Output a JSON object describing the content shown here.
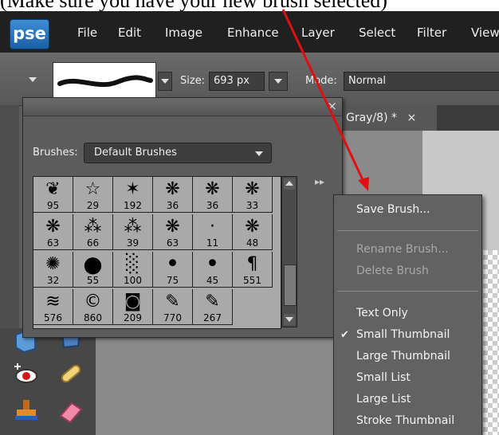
{
  "caption": {
    "text": "(Make sure you have your new brush selected)"
  },
  "app": {
    "logo": "pse"
  },
  "menubar": {
    "items": [
      "File",
      "Edit",
      "Image",
      "Enhance",
      "Layer",
      "Select",
      "Filter",
      "View"
    ]
  },
  "options_bar": {
    "size_label": "Size:",
    "size_value": "693 px",
    "mode_label": "Mode:",
    "mode_value": "Normal"
  },
  "document_tab": {
    "title": "Gray/8) *",
    "close": "×"
  },
  "brush_picker": {
    "brushes_label": "Brushes:",
    "brush_set": "Default Brushes",
    "close": "×",
    "expand": "▸▸",
    "brushes": [
      {
        "size": "95",
        "icon": "leaf-brush-icon"
      },
      {
        "size": "29",
        "icon": "star-brush-icon"
      },
      {
        "size": "192",
        "icon": "starburst-brush-icon"
      },
      {
        "size": "36",
        "icon": "grunge-brush-icon"
      },
      {
        "size": "36",
        "icon": "grunge-brush-icon"
      },
      {
        "size": "33",
        "icon": "grunge-brush-icon"
      },
      {
        "size": "63",
        "icon": "grunge-brush-icon"
      },
      {
        "size": "66",
        "icon": "spatter-brush-icon"
      },
      {
        "size": "39",
        "icon": "spatter-brush-icon"
      },
      {
        "size": "63",
        "icon": "grunge-brush-icon"
      },
      {
        "size": "11",
        "icon": "dot-brush-icon"
      },
      {
        "size": "48",
        "icon": "grunge-brush-icon"
      },
      {
        "size": "32",
        "icon": "splat-brush-icon"
      },
      {
        "size": "55",
        "icon": "hard-round-brush-icon"
      },
      {
        "size": "100",
        "icon": "texture-brush-icon"
      },
      {
        "size": "75",
        "icon": "soft-round-brush-icon"
      },
      {
        "size": "45",
        "icon": "soft-round-brush-icon"
      },
      {
        "size": "551",
        "icon": "text-brush-icon"
      },
      {
        "size": "576",
        "icon": "scribble-brush-icon"
      },
      {
        "size": "860",
        "icon": "copyright-brush-icon"
      },
      {
        "size": "209",
        "icon": "camera-brush-icon"
      },
      {
        "size": "770",
        "icon": "handwriting-brush-icon"
      },
      {
        "size": "267",
        "icon": "handwriting-brush-icon"
      }
    ]
  },
  "context_menu": {
    "save_brush": "Save Brush...",
    "rename_brush": "Rename Brush...",
    "delete_brush": "Delete Brush",
    "text_only": "Text Only",
    "small_thumbnail": "Small Thumbnail",
    "large_thumbnail": "Large Thumbnail",
    "small_list": "Small List",
    "large_list": "Large List",
    "stroke_thumbnail": "Stroke Thumbnail",
    "checkmark": "✔"
  },
  "colors": {
    "arrow": "#e01010",
    "menubar": "#202020",
    "panel": "#5c5c5c"
  }
}
